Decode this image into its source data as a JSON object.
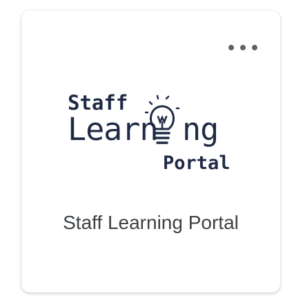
{
  "tile": {
    "title": "Staff Learning Portal",
    "menu_icon": "more-horizontal-icon",
    "logo": {
      "word_staff": "Staff",
      "word_learn": "Learn",
      "word_ng": "ng",
      "word_portal": "Portal",
      "icon": "lightbulb-icon",
      "color": "#1f2a44"
    }
  }
}
